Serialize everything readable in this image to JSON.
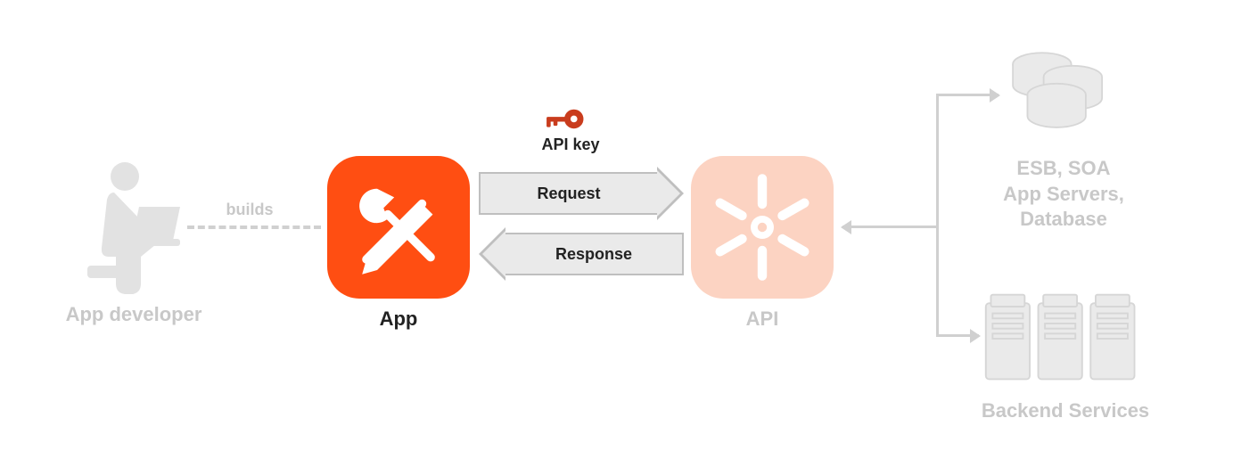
{
  "developer": {
    "label": "App developer"
  },
  "builds": {
    "label": "builds"
  },
  "app": {
    "label": "App"
  },
  "apiKey": {
    "label": "API key"
  },
  "arrows": {
    "request": "Request",
    "response": "Response"
  },
  "api": {
    "label": "API"
  },
  "backend": {
    "desc_line1": "ESB, SOA",
    "desc_line2": "App Servers,",
    "desc_line3": "Database",
    "label": "Backend Services"
  },
  "colors": {
    "accent": "#ff4e12",
    "accentLight": "#fcd3c2",
    "faded": "#c8c8c8",
    "keyRed": "#c93c1d"
  }
}
